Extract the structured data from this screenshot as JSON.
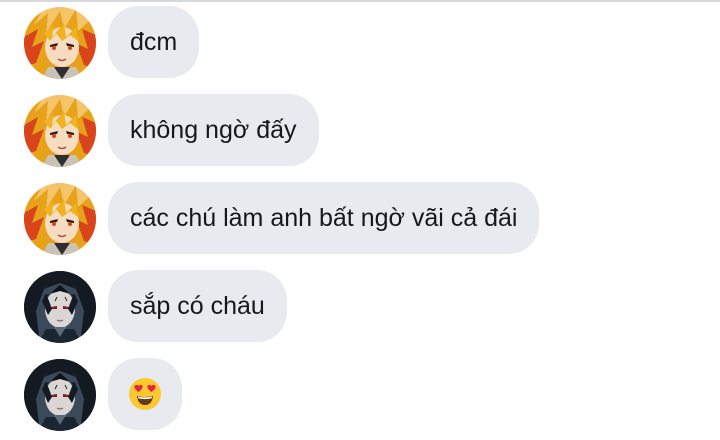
{
  "conversation": {
    "messages": [
      {
        "avatar": "flame-hair-avatar",
        "text": "đcm"
      },
      {
        "avatar": "flame-hair-avatar",
        "text": "không ngờ đấy"
      },
      {
        "avatar": "flame-hair-avatar",
        "text": "các chú làm anh bất ngờ vãi cả đái"
      },
      {
        "avatar": "dark-hair-avatar",
        "text": "sắp có cháu"
      },
      {
        "avatar": "dark-hair-avatar",
        "emoji": "heart-eyes-emoji"
      }
    ]
  },
  "colors": {
    "bubble": "#e7eaee",
    "text": "#15191d",
    "flame_primary": "#e8a21a",
    "flame_secondary": "#d8441b",
    "dark_primary": "#1f2a36"
  }
}
